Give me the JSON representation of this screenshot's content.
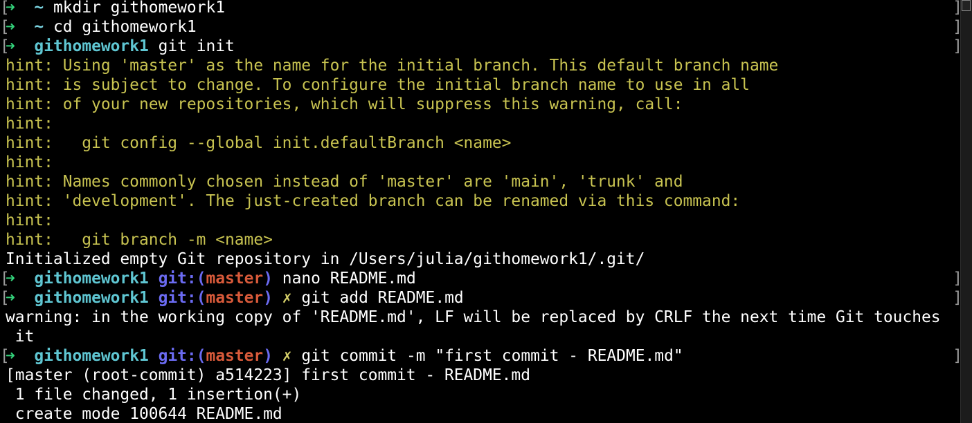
{
  "terminal": {
    "background": "#000000",
    "colors": {
      "arrow": "#33d17a",
      "directory": "#5fc6d2",
      "git_label": "#6b6bf2",
      "branch": "#d85a3a",
      "dirty_marker": "#d8d26a",
      "hint": "#c8c351",
      "output": "#ffffff"
    },
    "lines": [
      {
        "type": "prompt",
        "bracket": "[",
        "arrow": "➜",
        "dir": "~",
        "command": "mkdir githomework1",
        "end": "]"
      },
      {
        "type": "prompt",
        "bracket": "[",
        "arrow": "➜",
        "dir": "~",
        "command": "cd githomework1",
        "end": "]"
      },
      {
        "type": "prompt",
        "bracket": "[",
        "arrow": "➜",
        "dir": "githomework1",
        "command": "git init",
        "end": "]"
      },
      {
        "type": "hint",
        "text": "hint: Using 'master' as the name for the initial branch. This default branch name"
      },
      {
        "type": "hint",
        "text": "hint: is subject to change. To configure the initial branch name to use in all"
      },
      {
        "type": "hint",
        "text": "hint: of your new repositories, which will suppress this warning, call:"
      },
      {
        "type": "hint",
        "text": "hint:"
      },
      {
        "type": "hint",
        "text": "hint:   git config --global init.defaultBranch <name>"
      },
      {
        "type": "hint",
        "text": "hint:"
      },
      {
        "type": "hint",
        "text": "hint: Names commonly chosen instead of 'master' are 'main', 'trunk' and"
      },
      {
        "type": "hint",
        "text": "hint: 'development'. The just-created branch can be renamed via this command:"
      },
      {
        "type": "hint",
        "text": "hint:"
      },
      {
        "type": "hint",
        "text": "hint:   git branch -m <name>"
      },
      {
        "type": "output",
        "text": "Initialized empty Git repository in /Users/julia/githomework1/.git/"
      },
      {
        "type": "prompt",
        "bracket": "[",
        "arrow": "➜",
        "dir": "githomework1",
        "git": "git:(",
        "branch": "master",
        "git_close": ")",
        "command": "nano README.md",
        "end": "]"
      },
      {
        "type": "prompt",
        "bracket": "[",
        "arrow": "➜",
        "dir": "githomework1",
        "git": "git:(",
        "branch": "master",
        "git_close": ")",
        "dirty": "✗",
        "command": "git add README.md",
        "end": "]"
      },
      {
        "type": "output",
        "text": "warning: in the working copy of 'README.md', LF will be replaced by CRLF the next time Git touches"
      },
      {
        "type": "output",
        "text": " it"
      },
      {
        "type": "prompt",
        "bracket": "[",
        "arrow": "➜",
        "dir": "githomework1",
        "git": "git:(",
        "branch": "master",
        "git_close": ")",
        "dirty": "✗",
        "command": "git commit -m \"first commit - README.md\"",
        "end": "]"
      },
      {
        "type": "output",
        "text": "[master (root-commit) a514223] first commit - README.md"
      },
      {
        "type": "output",
        "text": " 1 file changed, 1 insertion(+)"
      },
      {
        "type": "output",
        "text": " create mode 100644 README.md"
      }
    ]
  }
}
